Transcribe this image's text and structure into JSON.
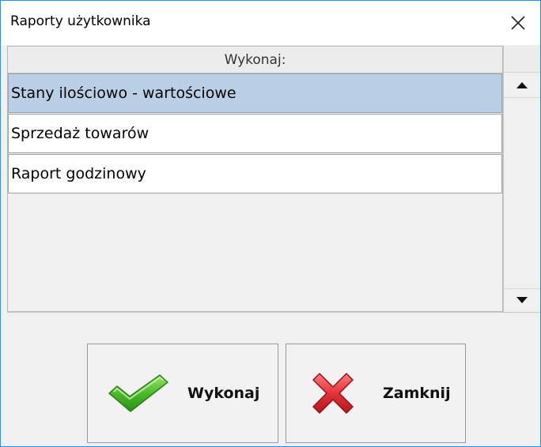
{
  "window": {
    "title": "Raporty użytkownika"
  },
  "table": {
    "column_header": "Wykonaj:",
    "rows": [
      {
        "label": "Stany ilościowo - wartościowe",
        "selected": true
      },
      {
        "label": "Sprzedaż towarów",
        "selected": false
      },
      {
        "label": "Raport godzinowy",
        "selected": false
      }
    ]
  },
  "buttons": {
    "run_label": "Wykonaj",
    "close_label": "Zamknij"
  },
  "icons": {
    "close": "close-icon",
    "run": "checkmark-icon",
    "cancel": "x-cross-icon",
    "scroll_up": "arrow-up-icon",
    "scroll_down": "arrow-down-icon"
  },
  "colors": {
    "selected_row": "#b8cfe5",
    "check_green": "#3aa51f",
    "cross_red": "#d8262d"
  }
}
